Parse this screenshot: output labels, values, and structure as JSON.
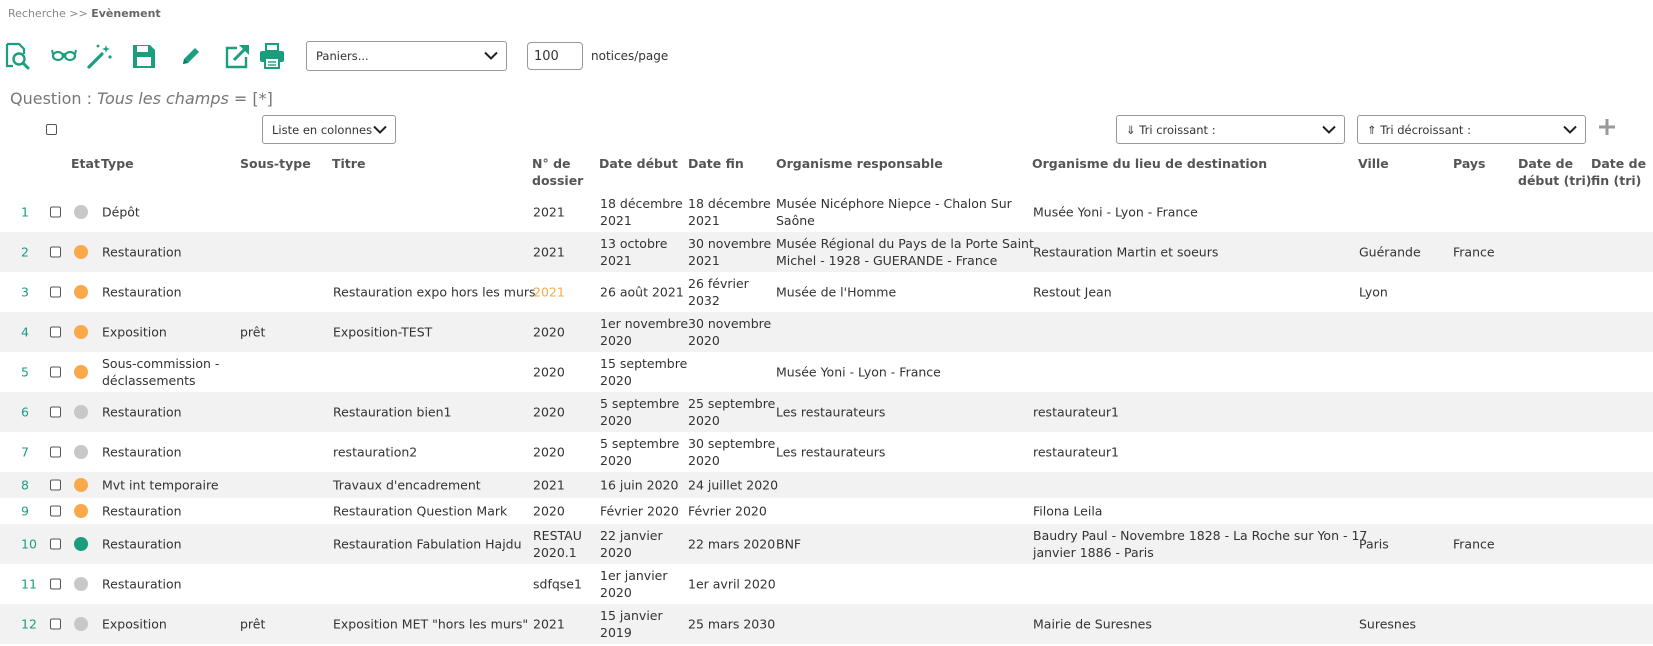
{
  "breadcrumb": {
    "parent": "Recherche",
    "separator": ">>",
    "current": "Evènement"
  },
  "colors": {
    "accent": "#1a9e7e",
    "orange": "#f9a94a",
    "grey": "#c8c8c8",
    "row_alt": "#f2f2f2"
  },
  "toolbar": {
    "icons": [
      "preview-search-icon",
      "glasses-icon",
      "magic-wand-icon",
      "save-icon",
      "pencil-icon",
      "export-icon",
      "print-icon"
    ],
    "basket_select": "Paniers...",
    "per_page_value": "100",
    "per_page_label": "notices/page"
  },
  "question": {
    "label": "Question :",
    "field": "Tous les champs",
    "operator": "= [*]"
  },
  "controls": {
    "view_mode": "Liste en colonnes",
    "sort_asc": "⇓ Tri croissant :",
    "sort_desc": "⇑ Tri décroissant :"
  },
  "columns": {
    "etat": "Etat",
    "type": "Type",
    "soustype": "Sous-type",
    "titre": "Titre",
    "dossier": [
      "N° de",
      "dossier"
    ],
    "debut": "Date début",
    "fin": "Date fin",
    "org": "Organisme responsable",
    "dest": "Organisme du lieu de destination",
    "ville": "Ville",
    "pays": "Pays",
    "debut_tri": [
      "Date de",
      "début (tri)"
    ],
    "fin_tri": [
      "Date de",
      "fin (tri)"
    ]
  },
  "rows": [
    {
      "num": "1",
      "status": "grey",
      "type": [
        "Dépôt"
      ],
      "soustype": "",
      "titre": "",
      "dossier": [
        "2021"
      ],
      "debut": [
        "18 décembre",
        "2021"
      ],
      "fin": [
        "18 décembre",
        "2021"
      ],
      "org": [
        "Musée Nicéphore Niepce - Chalon Sur",
        "Saône"
      ],
      "dest": [
        "Musée Yoni - Lyon - France"
      ],
      "ville": "",
      "pays": ""
    },
    {
      "num": "2",
      "status": "orange",
      "type": [
        "Restauration"
      ],
      "soustype": "",
      "titre": "",
      "dossier": [
        "2021"
      ],
      "debut": [
        "13 octobre",
        "2021"
      ],
      "fin": [
        "30 novembre",
        "2021"
      ],
      "org": [
        "Musée Régional du Pays de la Porte Saint",
        "Michel - 1928 - GUERANDE - France"
      ],
      "dest": [
        "Restauration Martin et soeurs"
      ],
      "ville": "Guérande",
      "pays": "France"
    },
    {
      "num": "3",
      "status": "orange",
      "type": [
        "Restauration"
      ],
      "soustype": "",
      "titre": "Restauration expo hors les murs",
      "dossier": [
        "2021"
      ],
      "dossier_hl": true,
      "debut": [
        "26 août 2021"
      ],
      "fin": [
        "26 février",
        "2032"
      ],
      "org": [
        "Musée de l'Homme"
      ],
      "dest": [
        "Restout Jean"
      ],
      "ville": "Lyon",
      "pays": ""
    },
    {
      "num": "4",
      "status": "orange",
      "type": [
        "Exposition"
      ],
      "soustype": "prêt",
      "titre": "Exposition-TEST",
      "dossier": [
        "2020"
      ],
      "debut": [
        "1er novembre",
        "2020"
      ],
      "fin": [
        "30 novembre",
        "2020"
      ],
      "org": [],
      "dest": [],
      "ville": "",
      "pays": ""
    },
    {
      "num": "5",
      "status": "orange",
      "type": [
        "Sous-commission -",
        "déclassements"
      ],
      "soustype": "",
      "titre": "",
      "dossier": [
        "2020"
      ],
      "debut": [
        "15 septembre",
        "2020"
      ],
      "fin": [],
      "org": [
        "Musée Yoni - Lyon - France"
      ],
      "dest": [],
      "ville": "",
      "pays": ""
    },
    {
      "num": "6",
      "status": "grey",
      "type": [
        "Restauration"
      ],
      "soustype": "",
      "titre": "Restauration bien1",
      "dossier": [
        "2020"
      ],
      "debut": [
        "5 septembre",
        "2020"
      ],
      "fin": [
        "25 septembre",
        "2020"
      ],
      "org": [
        "Les restaurateurs"
      ],
      "dest": [
        "restaurateur1"
      ],
      "ville": "",
      "pays": ""
    },
    {
      "num": "7",
      "status": "grey",
      "type": [
        "Restauration"
      ],
      "soustype": "",
      "titre": "restauration2",
      "dossier": [
        "2020"
      ],
      "debut": [
        "5 septembre",
        "2020"
      ],
      "fin": [
        "30 septembre",
        "2020"
      ],
      "org": [
        "Les restaurateurs"
      ],
      "dest": [
        "restaurateur1"
      ],
      "ville": "",
      "pays": ""
    },
    {
      "num": "8",
      "status": "orange",
      "type": [
        "Mvt int temporaire"
      ],
      "soustype": "",
      "titre": "Travaux d'encadrement",
      "dossier": [
        "2021"
      ],
      "debut": [
        "16 juin 2020"
      ],
      "fin": [
        "24 juillet 2020"
      ],
      "org": [],
      "dest": [],
      "ville": "",
      "pays": ""
    },
    {
      "num": "9",
      "status": "orange",
      "type": [
        "Restauration"
      ],
      "soustype": "",
      "titre": "Restauration Question Mark",
      "dossier": [
        "2020"
      ],
      "debut": [
        "Février 2020"
      ],
      "fin": [
        "Février 2020"
      ],
      "org": [],
      "dest": [
        "Filona Leila"
      ],
      "ville": "",
      "pays": ""
    },
    {
      "num": "10",
      "status": "green",
      "type": [
        "Restauration"
      ],
      "soustype": "",
      "titre": "Restauration Fabulation Hajdu",
      "dossier": [
        "RESTAU",
        "2020.1"
      ],
      "debut": [
        "22 janvier",
        "2020"
      ],
      "fin": [
        "22 mars 2020"
      ],
      "org": [
        "BNF"
      ],
      "dest": [
        "Baudry Paul - Novembre 1828 - La Roche sur Yon - 17",
        "janvier 1886 - Paris"
      ],
      "ville": "Paris",
      "pays": "France"
    },
    {
      "num": "11",
      "status": "grey",
      "type": [
        "Restauration"
      ],
      "soustype": "",
      "titre": "",
      "dossier": [
        "sdfqse1"
      ],
      "debut": [
        "1er janvier",
        "2020"
      ],
      "fin": [
        "1er avril 2020"
      ],
      "org": [],
      "dest": [],
      "ville": "",
      "pays": ""
    },
    {
      "num": "12",
      "status": "grey",
      "type": [
        "Exposition"
      ],
      "soustype": "prêt",
      "titre": "Exposition MET \"hors les murs\"",
      "dossier": [
        "2021"
      ],
      "debut": [
        "15 janvier",
        "2019"
      ],
      "fin": [
        "25 mars 2030"
      ],
      "org": [],
      "dest": [
        "Mairie de Suresnes"
      ],
      "ville": "Suresnes",
      "pays": ""
    }
  ]
}
